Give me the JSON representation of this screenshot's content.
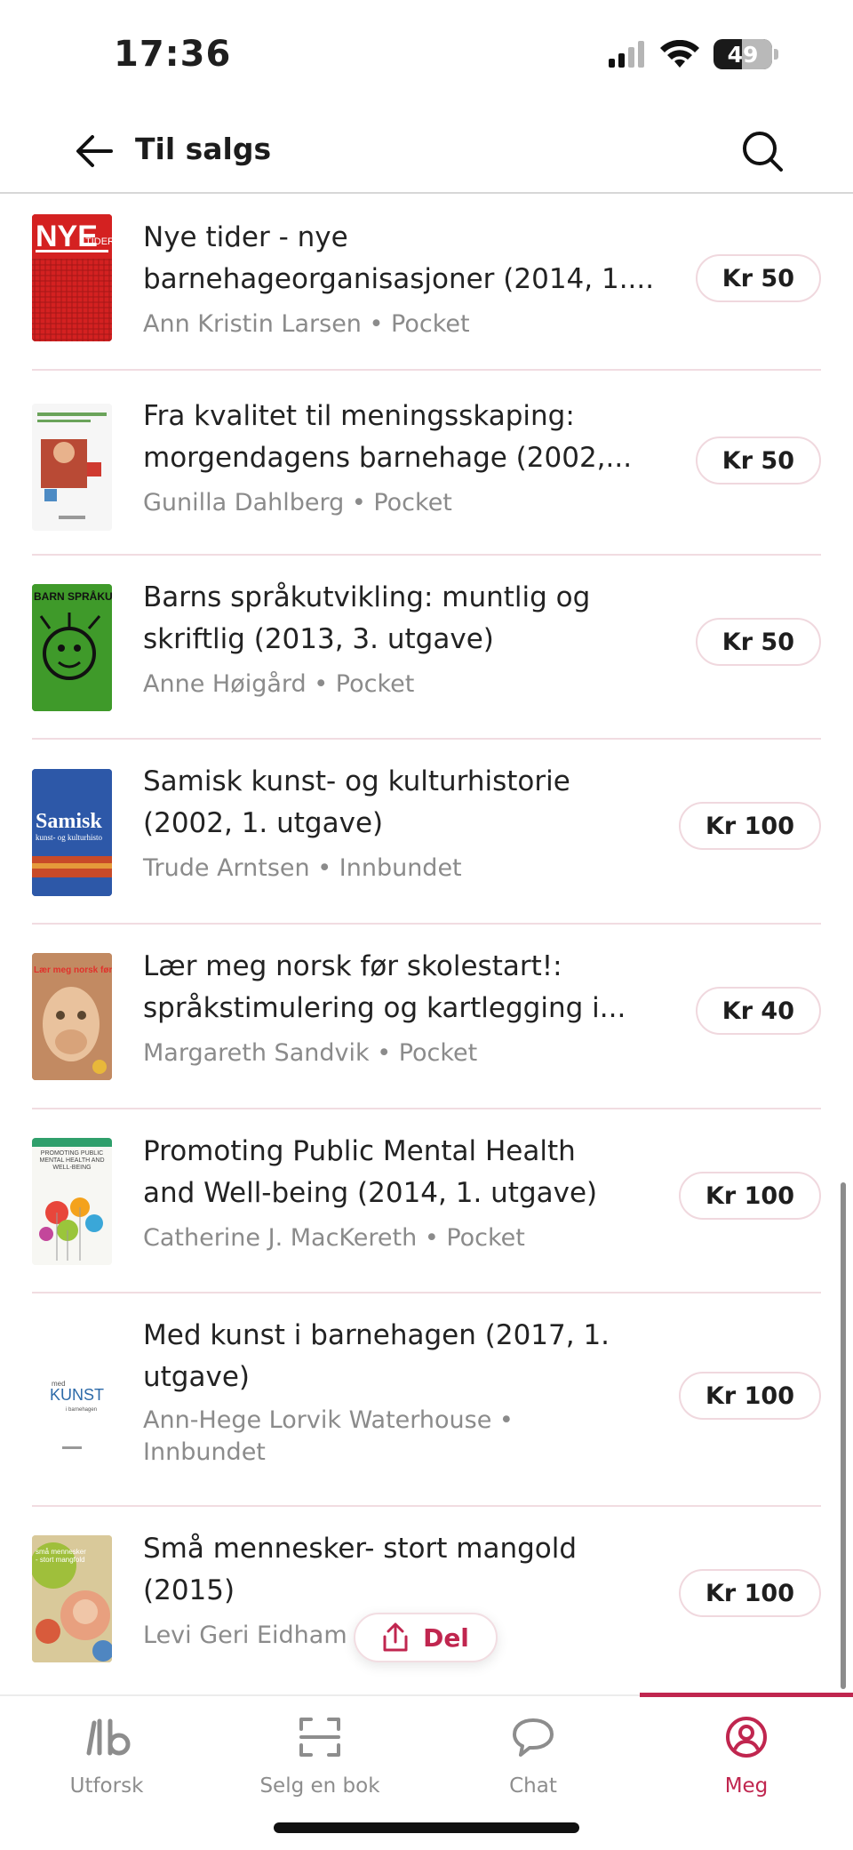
{
  "status": {
    "time": "17:36",
    "battery": "49",
    "battery_level": 0.49
  },
  "header": {
    "title": "Til salgs"
  },
  "items": [
    {
      "title_line1": "Nye tider - nye",
      "title_line2": "barnehageorganisasjoner (2014, 1....",
      "author": "Ann Kristin Larsen",
      "format": "Pocket",
      "price": "Kr 50",
      "cover": {
        "text": "NYE",
        "text2": "TIDER",
        "bg": "#d42121"
      }
    },
    {
      "title_line1": "Fra kvalitet til meningsskaping:",
      "title_line2": "morgendagens barnehage (2002,...",
      "author": "Gunilla Dahlberg",
      "format": "Pocket",
      "price": "Kr 50",
      "cover": {
        "bg": "#f6f6f6"
      }
    },
    {
      "title_line1": "Barns språkutvikling: muntlig og",
      "title_line2": "skriftlig (2013, 3. utgave)",
      "author": "Anne Høigård",
      "format": "Pocket",
      "price": "Kr 50",
      "cover": {
        "text": "BARN SPRÅKUTVIKLIN",
        "bg": "#3f9a2a"
      }
    },
    {
      "title_line1": "Samisk kunst- og kulturhistorie",
      "title_line2": "(2002, 1. utgave)",
      "author": "Trude Arntsen",
      "format": "Innbundet",
      "price": "Kr 100",
      "cover": {
        "text": "Samisk",
        "text2": "kunst- og kulturhisto",
        "bg": "#2d58a8"
      }
    },
    {
      "title_line1": "Lær meg norsk før skolestart!:",
      "title_line2": "språkstimulering og kartlegging i...",
      "author": "Margareth Sandvik",
      "format": "Pocket",
      "price": "Kr 40",
      "cover": {
        "text": "Lær meg norsk før skolestart!",
        "bg": "#b77b56"
      }
    },
    {
      "title_line1": "Promoting Public Mental Health",
      "title_line2": "and Well-being (2014, 1. utgave)",
      "author": "Catherine J. MacKereth",
      "format": "Pocket",
      "price": "Kr 100",
      "cover": {
        "text": "PROMOTING PUBLIC MENTAL HEALTH AND WELL-BEING",
        "bg": "#f7f7f3"
      }
    },
    {
      "title_line1": "Med kunst i barnehagen (2017, 1.",
      "title_line2": "utgave)",
      "author": "Ann-Hege Lorvik Waterhouse",
      "format": "Innbundet",
      "price": "Kr 100",
      "cover": {
        "text": "KUNST",
        "text2": "med",
        "text3": "i barnehagen",
        "bg": "#ffffff"
      }
    },
    {
      "title_line1": "Små mennesker- stort mangold",
      "title_line2": "(2015)",
      "author": "Levi Geri Eidham",
      "format": "",
      "price": "Kr 100",
      "cover": {
        "text": "små mennesker - stort mangfold",
        "bg": "#d7c48c"
      }
    }
  ],
  "share": {
    "label": "Del"
  },
  "nav": [
    {
      "label": "Utforsk",
      "icon": "logo-icon"
    },
    {
      "label": "Selg en bok",
      "icon": "scan-icon"
    },
    {
      "label": "Chat",
      "icon": "chat-icon"
    },
    {
      "label": "Meg",
      "icon": "profile-icon",
      "active": true
    }
  ],
  "colors": {
    "accent": "#c0264f",
    "divider": "#f1dce1"
  }
}
